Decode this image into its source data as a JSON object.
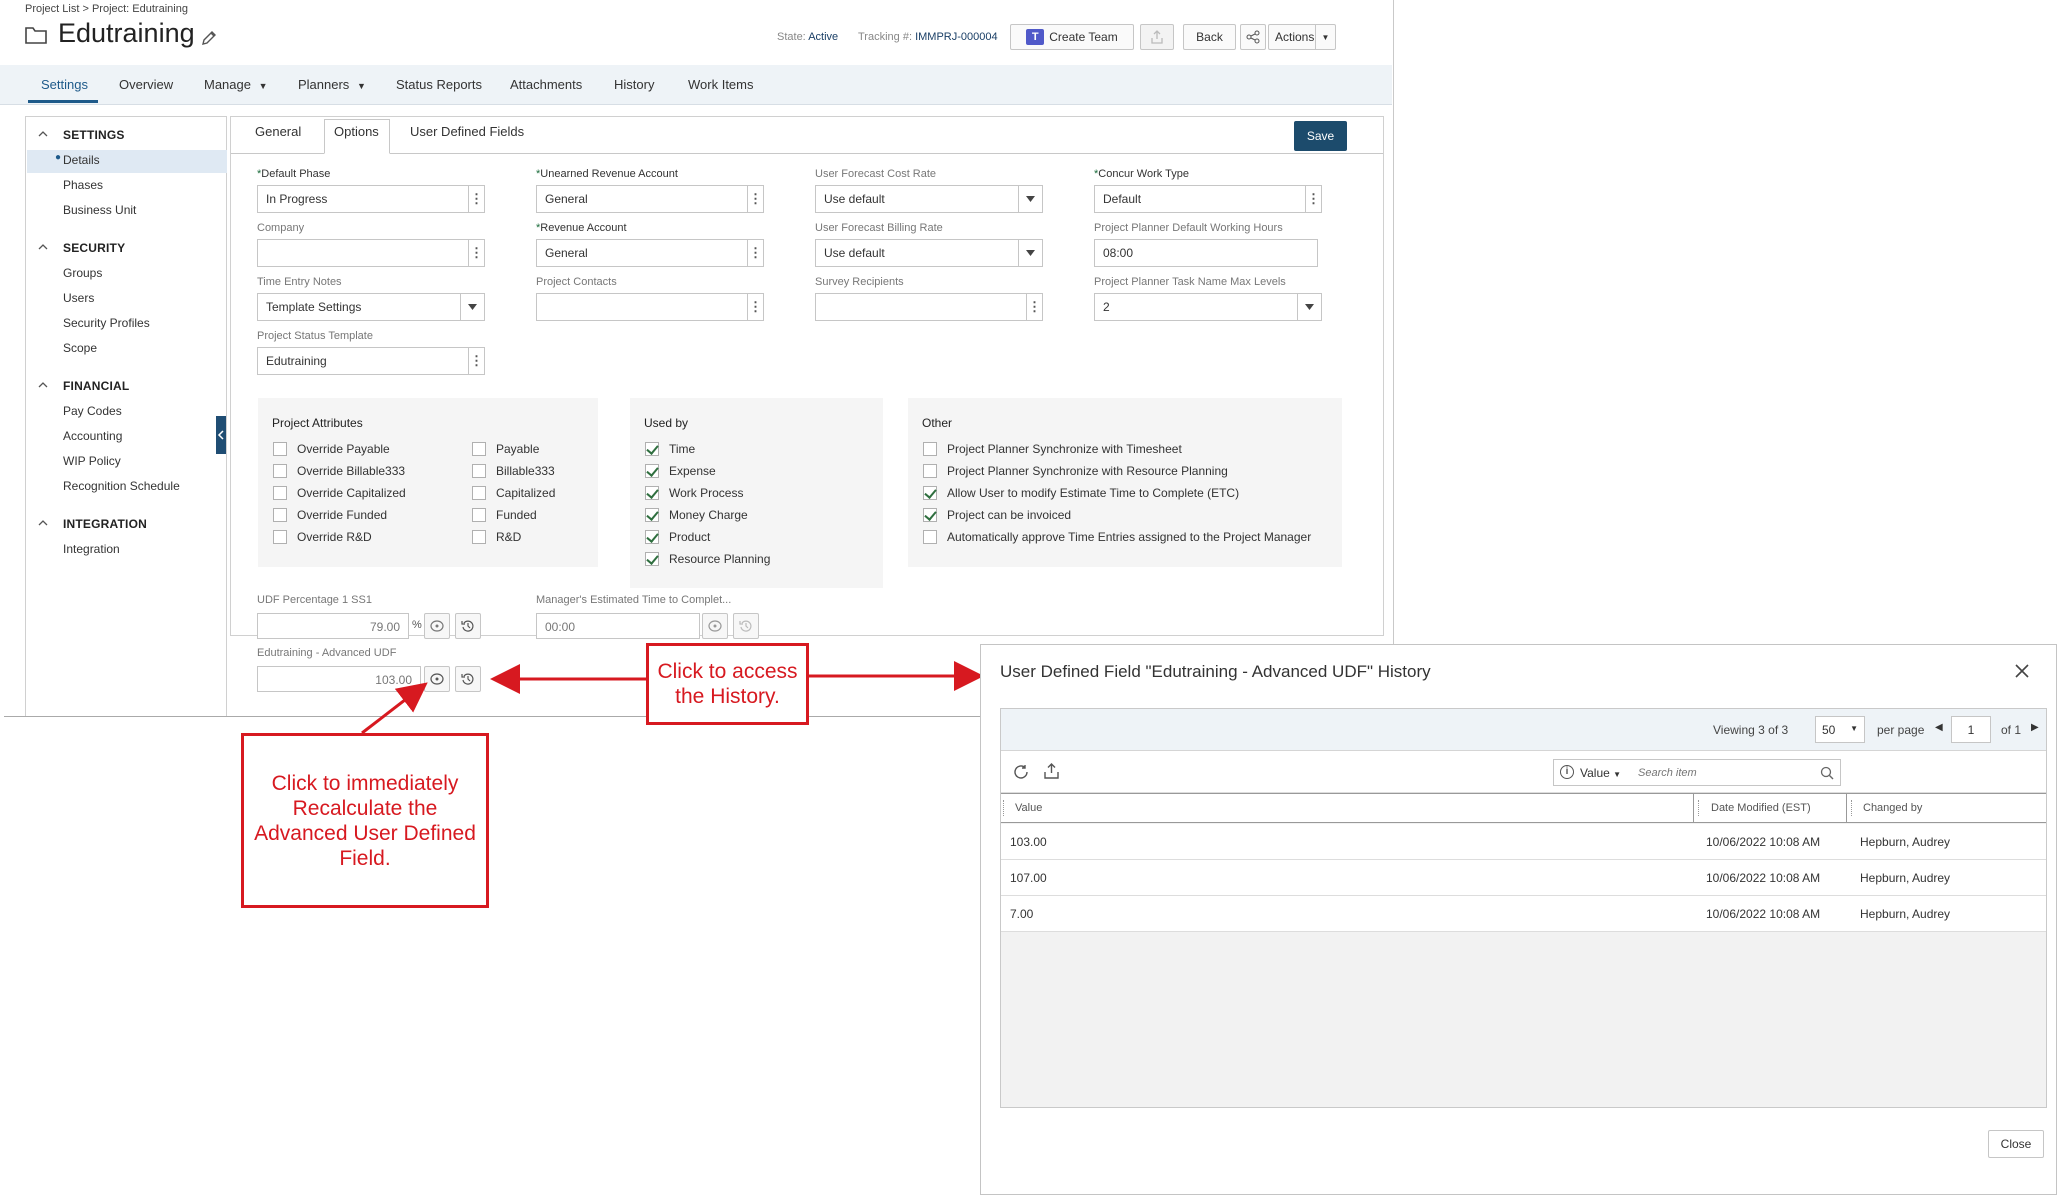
{
  "app": {
    "breadcrumb": "Project List > Project: Edutraining",
    "title": "Edutraining",
    "state_label": "State:",
    "state_value": "Active",
    "tracking_label": "Tracking #:",
    "tracking_value": "IMMPRJ-000004",
    "create_team_label": "Create Team",
    "back_label": "Back",
    "actions_label": "Actions"
  },
  "tabs": [
    "Settings",
    "Overview",
    "Manage",
    "Planners",
    "Status Reports",
    "Attachments",
    "History",
    "Work Items"
  ],
  "sidebar": {
    "sections": [
      {
        "heading": "SETTINGS",
        "items": [
          "Details",
          "Phases",
          "Business Unit"
        ]
      },
      {
        "heading": "SECURITY",
        "items": [
          "Groups",
          "Users",
          "Security Profiles",
          "Scope"
        ]
      },
      {
        "heading": "FINANCIAL",
        "items": [
          "Pay Codes",
          "Accounting",
          "WIP Policy",
          "Recognition Schedule"
        ]
      },
      {
        "heading": "INTEGRATION",
        "items": [
          "Integration"
        ]
      }
    ],
    "selected": "Details"
  },
  "content_tabs": [
    "General",
    "Options",
    "User Defined Fields"
  ],
  "save_label": "Save",
  "fields": {
    "default_phase": {
      "label": "Default Phase",
      "value": "In Progress"
    },
    "unearned_revenue": {
      "label": "Unearned Revenue Account",
      "value": "General"
    },
    "forecast_cost_rate": {
      "label": "User Forecast Cost Rate",
      "value": "Use default"
    },
    "concur_work_type": {
      "label": "Concur Work Type",
      "value": "Default"
    },
    "company": {
      "label": "Company",
      "value": ""
    },
    "revenue_account": {
      "label": "Revenue Account",
      "value": "General"
    },
    "forecast_billing_rate": {
      "label": "User Forecast Billing Rate",
      "value": "Use default"
    },
    "planner_working_hours": {
      "label": "Project Planner Default Working Hours",
      "value": "08:00"
    },
    "time_entry_notes": {
      "label": "Time Entry Notes",
      "value": "Template Settings"
    },
    "project_contacts": {
      "label": "Project Contacts",
      "value": ""
    },
    "survey_recipients": {
      "label": "Survey Recipients",
      "value": ""
    },
    "task_name_levels": {
      "label": "Project Planner Task Name Max Levels",
      "value": "2"
    },
    "status_template": {
      "label": "Project Status Template",
      "value": "Edutraining"
    }
  },
  "attributes": {
    "title": "Project Attributes",
    "left": [
      {
        "label": "Override Payable",
        "checked": false
      },
      {
        "label": "Override Billable333",
        "checked": false
      },
      {
        "label": "Override Capitalized",
        "checked": false
      },
      {
        "label": "Override Funded",
        "checked": false
      },
      {
        "label": "Override R&D",
        "checked": false
      }
    ],
    "right": [
      {
        "label": "Payable",
        "checked": false
      },
      {
        "label": "Billable333",
        "checked": false
      },
      {
        "label": "Capitalized",
        "checked": false
      },
      {
        "label": "Funded",
        "checked": false
      },
      {
        "label": "R&D",
        "checked": false
      }
    ]
  },
  "used_by": {
    "title": "Used by",
    "items": [
      {
        "label": "Time",
        "checked": true
      },
      {
        "label": "Expense",
        "checked": true
      },
      {
        "label": "Work Process",
        "checked": true
      },
      {
        "label": "Money Charge",
        "checked": true
      },
      {
        "label": "Product",
        "checked": true
      },
      {
        "label": "Resource Planning",
        "checked": true
      }
    ]
  },
  "other": {
    "title": "Other",
    "items": [
      {
        "label": "Project Planner Synchronize with Timesheet",
        "checked": false
      },
      {
        "label": "Project Planner Synchronize with Resource Planning",
        "checked": false
      },
      {
        "label": "Allow User to modify Estimate Time to Complete (ETC)",
        "checked": true
      },
      {
        "label": "Project can be invoiced",
        "checked": true
      },
      {
        "label": "Automatically approve Time Entries assigned to the Project Manager",
        "checked": false
      }
    ]
  },
  "udf": {
    "pct_label": "UDF Percentage 1 SS1",
    "pct_value": "79.00",
    "pct_unit": "%",
    "etc_label": "Manager's Estimated Time to Complet...",
    "etc_value": "00:00",
    "adv_label": "Edutraining - Advanced UDF",
    "adv_value": "103.00"
  },
  "callouts": {
    "history": "Click to access the History.",
    "recalc": "Click to immediately Recalculate the Advanced User Defined Field."
  },
  "modal": {
    "title": "User Defined Field \"Edutraining - Advanced UDF\" History",
    "viewing_prefix": "Viewing",
    "viewing": "3 of 3",
    "per_page_value": "50",
    "per_page_label": "per page",
    "page_value": "1",
    "page_of": "of 1",
    "filter_label": "Value",
    "search_placeholder": "Search item",
    "columns": [
      "Value",
      "Date Modified (EST)",
      "Changed by"
    ],
    "rows": [
      {
        "value": "103.00",
        "date": "10/06/2022 10:08 AM",
        "by": "Hepburn, Audrey"
      },
      {
        "value": "107.00",
        "date": "10/06/2022 10:08 AM",
        "by": "Hepburn, Audrey"
      },
      {
        "value": "7.00",
        "date": "10/06/2022 10:08 AM",
        "by": "Hepburn, Audrey"
      }
    ],
    "close_label": "Close"
  },
  "colors": {
    "accent": "#1c4b6c",
    "callout_red": "#d71920",
    "check_green": "#2f6f3f"
  }
}
